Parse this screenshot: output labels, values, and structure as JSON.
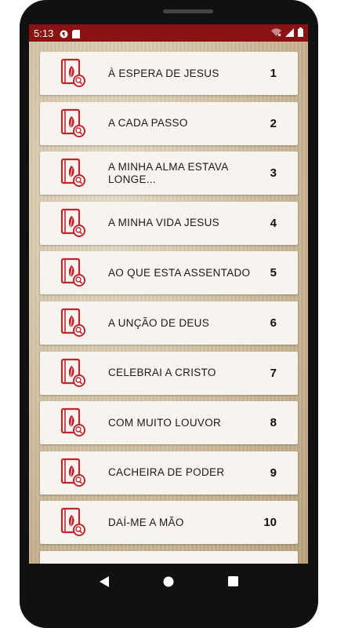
{
  "status_bar": {
    "time": "5:13",
    "icons_left": [
      "app-notification-icon",
      "sd-card-icon"
    ],
    "icons_right": [
      "wifi-off-icon",
      "signal-icon",
      "battery-icon"
    ]
  },
  "colors": {
    "status_bar": "#8b1212",
    "icon_red": "#c0242c",
    "card_background": "#f7f3ee"
  },
  "items": [
    {
      "title": "À ESPERA DE JESUS",
      "number": "1"
    },
    {
      "title": "A CADA PASSO",
      "number": "2"
    },
    {
      "title": "A MINHA ALMA ESTAVA LONGE...",
      "number": "3"
    },
    {
      "title": "A MINHA VIDA JESUS",
      "number": "4"
    },
    {
      "title": "AO QUE ESTA ASSENTADO",
      "number": "5"
    },
    {
      "title": "A UNÇÃO DE DEUS",
      "number": "6"
    },
    {
      "title": "CELEBRAI A CRISTO",
      "number": "7"
    },
    {
      "title": "COM MUITO LOUVOR",
      "number": "8"
    },
    {
      "title": "CACHEIRA DE PODER",
      "number": "9"
    },
    {
      "title": "DAÍ-ME A MÃO",
      "number": "10"
    }
  ],
  "navigation": {
    "buttons": [
      "back-icon",
      "home-icon",
      "recents-icon"
    ]
  }
}
